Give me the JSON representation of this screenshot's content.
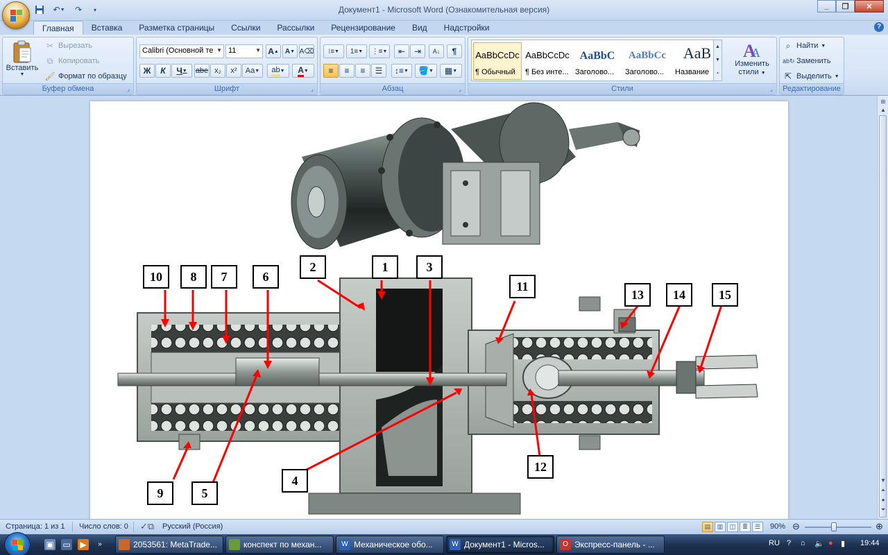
{
  "window": {
    "title": "Документ1 - Microsoft Word (Ознакомительная версия)"
  },
  "quick_access": {
    "save_icon": "save-icon",
    "undo_icon": "undo-icon",
    "redo_icon": "redo-icon",
    "customize_icon": "customize-icon"
  },
  "tabs": [
    {
      "label": "Главная",
      "active": true
    },
    {
      "label": "Вставка"
    },
    {
      "label": "Разметка страницы"
    },
    {
      "label": "Ссылки"
    },
    {
      "label": "Рассылки"
    },
    {
      "label": "Рецензирование"
    },
    {
      "label": "Вид"
    },
    {
      "label": "Надстройки"
    }
  ],
  "ribbon": {
    "clipboard": {
      "label": "Буфер обмена",
      "paste": "Вставить",
      "cut": "Вырезать",
      "copy": "Копировать",
      "format_painter": "Формат по образцу"
    },
    "font": {
      "label": "Шрифт",
      "font_name": "Calibri (Основной те",
      "font_size": "11",
      "bold": "Ж",
      "italic": "К",
      "underline": "Ч",
      "strike": "abe",
      "subscript": "x₂",
      "superscript": "x²",
      "change_case": "Aa",
      "grow": "A",
      "shrink": "A"
    },
    "paragraph": {
      "label": "Абзац"
    },
    "styles": {
      "label": "Стили",
      "items": [
        {
          "sample": "AaBbCcDc",
          "name": "¶ Обычный",
          "active": true
        },
        {
          "sample": "AaBbCcDc",
          "name": "¶ Без инте..."
        },
        {
          "sample": "AaBbC",
          "name": "Заголово..."
        },
        {
          "sample": "AaBbCc",
          "name": "Заголово..."
        },
        {
          "sample": "AaB",
          "name": "Название"
        }
      ],
      "change_styles_line1": "Изменить",
      "change_styles_line2": "стили"
    },
    "editing": {
      "label": "Редактирование",
      "find": "Найти",
      "replace": "Заменить",
      "select": "Выделить"
    }
  },
  "figure": {
    "callouts": [
      "10",
      "8",
      "7",
      "6",
      "2",
      "1",
      "3",
      "11",
      "13",
      "14",
      "15",
      "9",
      "5",
      "4",
      "12"
    ]
  },
  "statusbar": {
    "page": "Страница: 1 из 1",
    "words": "Число слов: 0",
    "language": "Русский (Россия)",
    "zoom": "90%",
    "zoom_value": 0.9
  },
  "taskbar": {
    "tasks": [
      {
        "label": "2053561: MetaTrade...",
        "icon_color": "#c8692b"
      },
      {
        "label": "конспект по механ...",
        "icon_color": "#6a9a3a"
      },
      {
        "label": "Механическое обо...",
        "icon_color": "#2b62b6"
      },
      {
        "label": "Документ1 - Micros...",
        "icon_color": "#2b62b6",
        "active": true
      },
      {
        "label": "Экспресс-панель - ...",
        "icon_color": "#c8322a"
      }
    ],
    "language": "RU",
    "clock": "19:44"
  }
}
